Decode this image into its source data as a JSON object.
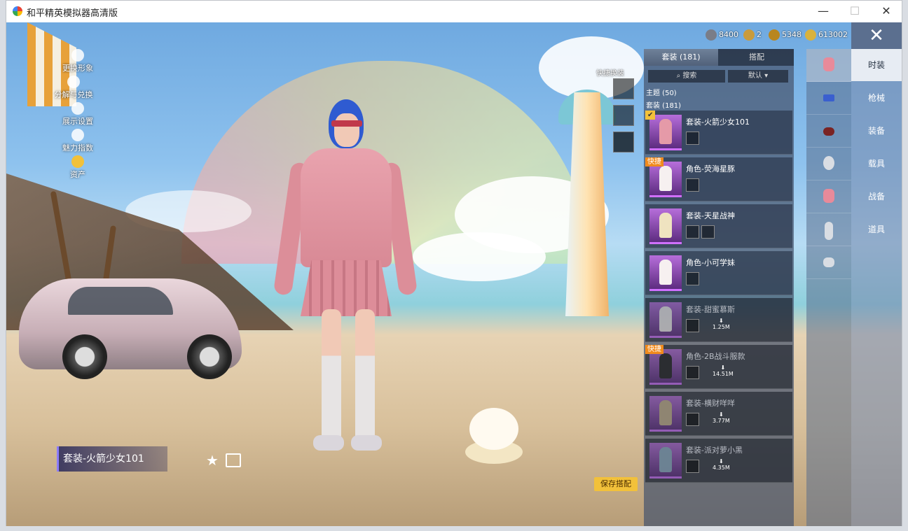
{
  "window": {
    "title": "和平精英模拟器高清版",
    "minimize": "—",
    "maximize": "☐",
    "close": "✕"
  },
  "currency": [
    {
      "value": "8400",
      "color": "#7a7d88",
      "icon": "coin-gray-icon"
    },
    {
      "value": "2",
      "color": "#c99b3b",
      "icon": "coin-a-icon"
    },
    {
      "value": "5348",
      "color": "#b8861f",
      "icon": "coin-bronze-icon"
    },
    {
      "value": "613002",
      "color": "#d9b23d",
      "icon": "coin-gold-icon"
    }
  ],
  "left_menu": [
    {
      "label": "更换形象",
      "icon": "person-icon"
    },
    {
      "label": "分解与兑换",
      "icon": "gear-icon"
    },
    {
      "label": "展示设置",
      "icon": "eye-icon"
    },
    {
      "label": "魅力指数",
      "icon": "flame-icon"
    },
    {
      "label": "资产",
      "icon": "crown-icon"
    }
  ],
  "quick_change": {
    "label": "快捷换装"
  },
  "current_outfit": {
    "name": "套装-火箭少女101"
  },
  "save_button": "保存搭配",
  "close_button": "✕",
  "panel": {
    "tabs": [
      {
        "label": "套装 (181)",
        "active": true
      },
      {
        "label": "搭配",
        "active": false
      }
    ],
    "search_label": "搜索",
    "sort_label": "默认",
    "theme_section": "主题 (50)",
    "suit_section": "套装 (181)",
    "items": [
      {
        "name": "套装-火箭少女101",
        "badge": "",
        "download": "",
        "equipped": true,
        "dim": false
      },
      {
        "name": "角色-荧海星豚",
        "badge": "快捷",
        "download": "",
        "equipped": false,
        "dim": false
      },
      {
        "name": "套装-天星战神",
        "badge": "",
        "download": "",
        "equipped": false,
        "dim": false
      },
      {
        "name": "角色-小可学妹",
        "badge": "",
        "download": "",
        "equipped": false,
        "dim": false
      },
      {
        "name": "套装-甜蜜慕斯",
        "badge": "",
        "download": "1.25M",
        "equipped": false,
        "dim": true
      },
      {
        "name": "角色-2B战斗服款",
        "badge": "快捷",
        "download": "14.51M",
        "equipped": false,
        "dim": true
      },
      {
        "name": "套装-横财咩咩",
        "badge": "",
        "download": "3.77M",
        "equipped": false,
        "dim": true
      },
      {
        "name": "套装-派对萝小黑",
        "badge": "",
        "download": "4.35M",
        "equipped": false,
        "dim": true
      }
    ]
  },
  "category_icons": [
    {
      "icon": "coat-icon",
      "color": "#e88a9a"
    },
    {
      "icon": "rifle-icon",
      "color": "#3a5fcf"
    },
    {
      "icon": "helmet-icon",
      "color": "#7a2323"
    },
    {
      "icon": "mask-icon",
      "color": "#d9dde3"
    },
    {
      "icon": "outfit-icon",
      "color": "#e88a9a"
    },
    {
      "icon": "pants-icon",
      "color": "#d9dde3"
    },
    {
      "icon": "socks-icon",
      "color": "#d9dde3"
    }
  ],
  "right_tabs": [
    {
      "label": "时装",
      "active": true
    },
    {
      "label": "枪械",
      "active": false
    },
    {
      "label": "装备",
      "active": false
    },
    {
      "label": "载具",
      "active": false
    },
    {
      "label": "战备",
      "active": false
    },
    {
      "label": "道具",
      "active": false
    }
  ]
}
